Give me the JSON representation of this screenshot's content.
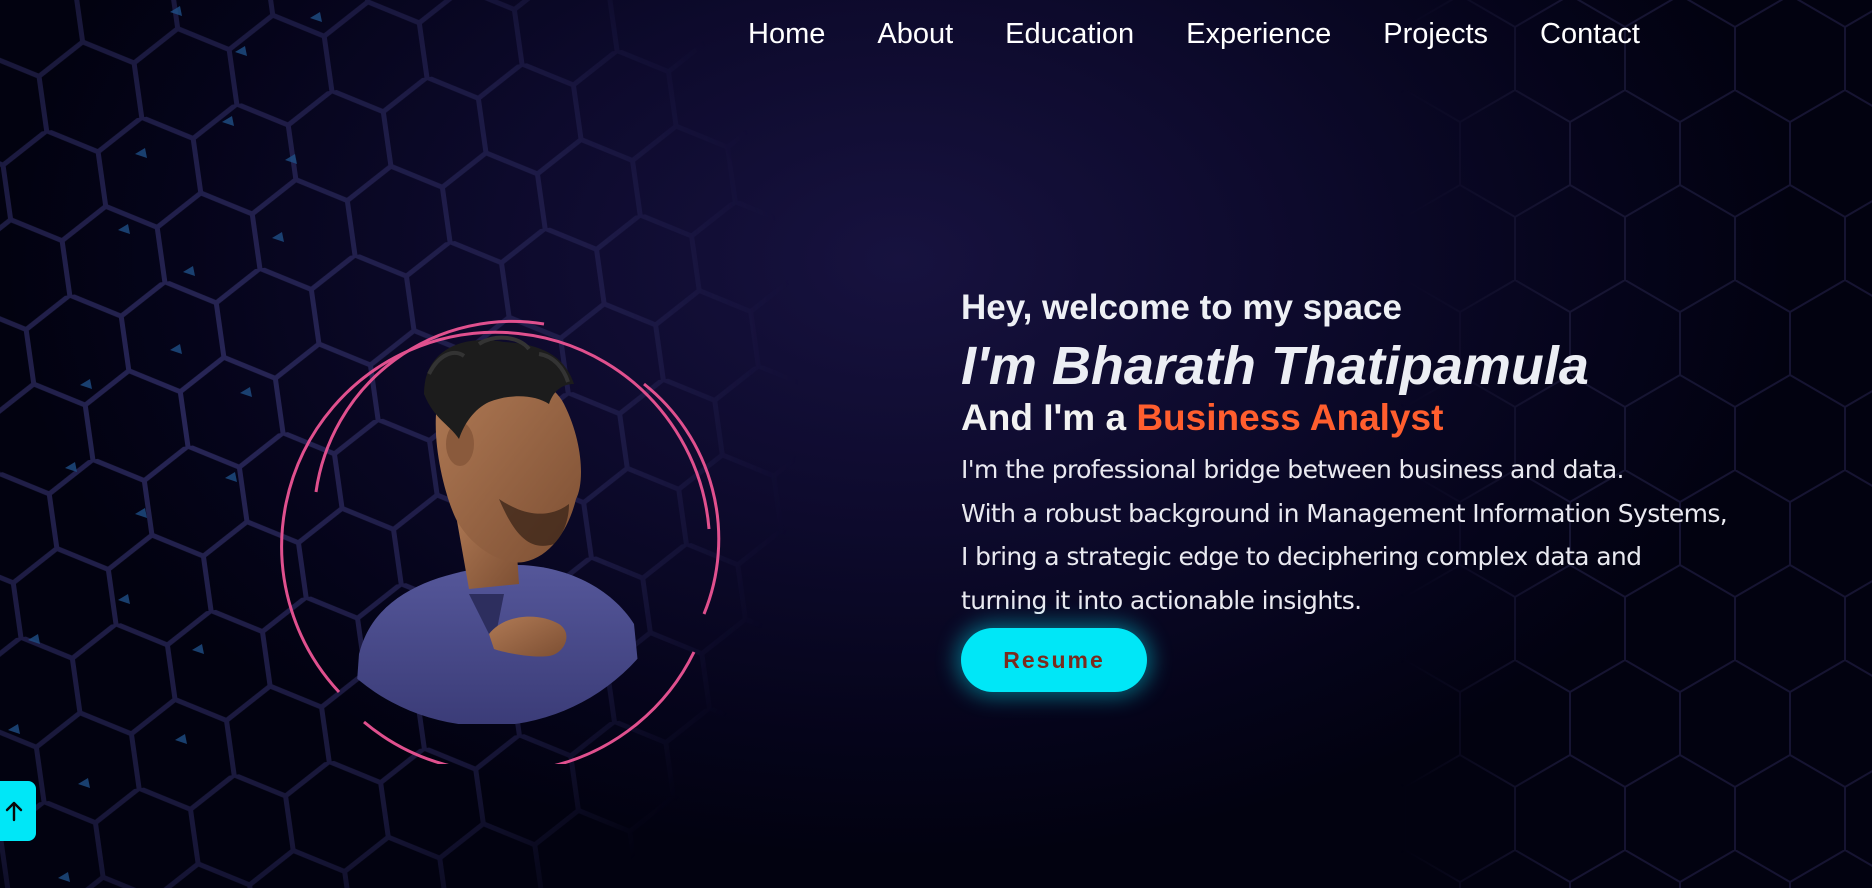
{
  "nav": {
    "items": [
      {
        "label": "Home"
      },
      {
        "label": "About"
      },
      {
        "label": "Education"
      },
      {
        "label": "Experience"
      },
      {
        "label": "Projects"
      },
      {
        "label": "Contact"
      }
    ]
  },
  "hero": {
    "greeting": "Hey, welcome to my space",
    "name": "I'm Bharath Thatipamula",
    "role_prefix": "And I'm a ",
    "role_highlight": "Business Analyst",
    "description_lines": [
      "I'm the professional bridge between business and data.",
      "With a robust background in Management Information Systems,",
      "I bring a strategic edge to deciphering complex data and",
      "turning it into actionable insights."
    ],
    "resume_label": "Resume"
  },
  "icons": {
    "scroll_top": "arrow-up-icon",
    "profile": "profile-photo"
  },
  "colors": {
    "accent_orange": "#ff5e2e",
    "button_cyan": "#00e7f7",
    "ring_pink": "#e0508e",
    "background": "#0d0a2c"
  }
}
